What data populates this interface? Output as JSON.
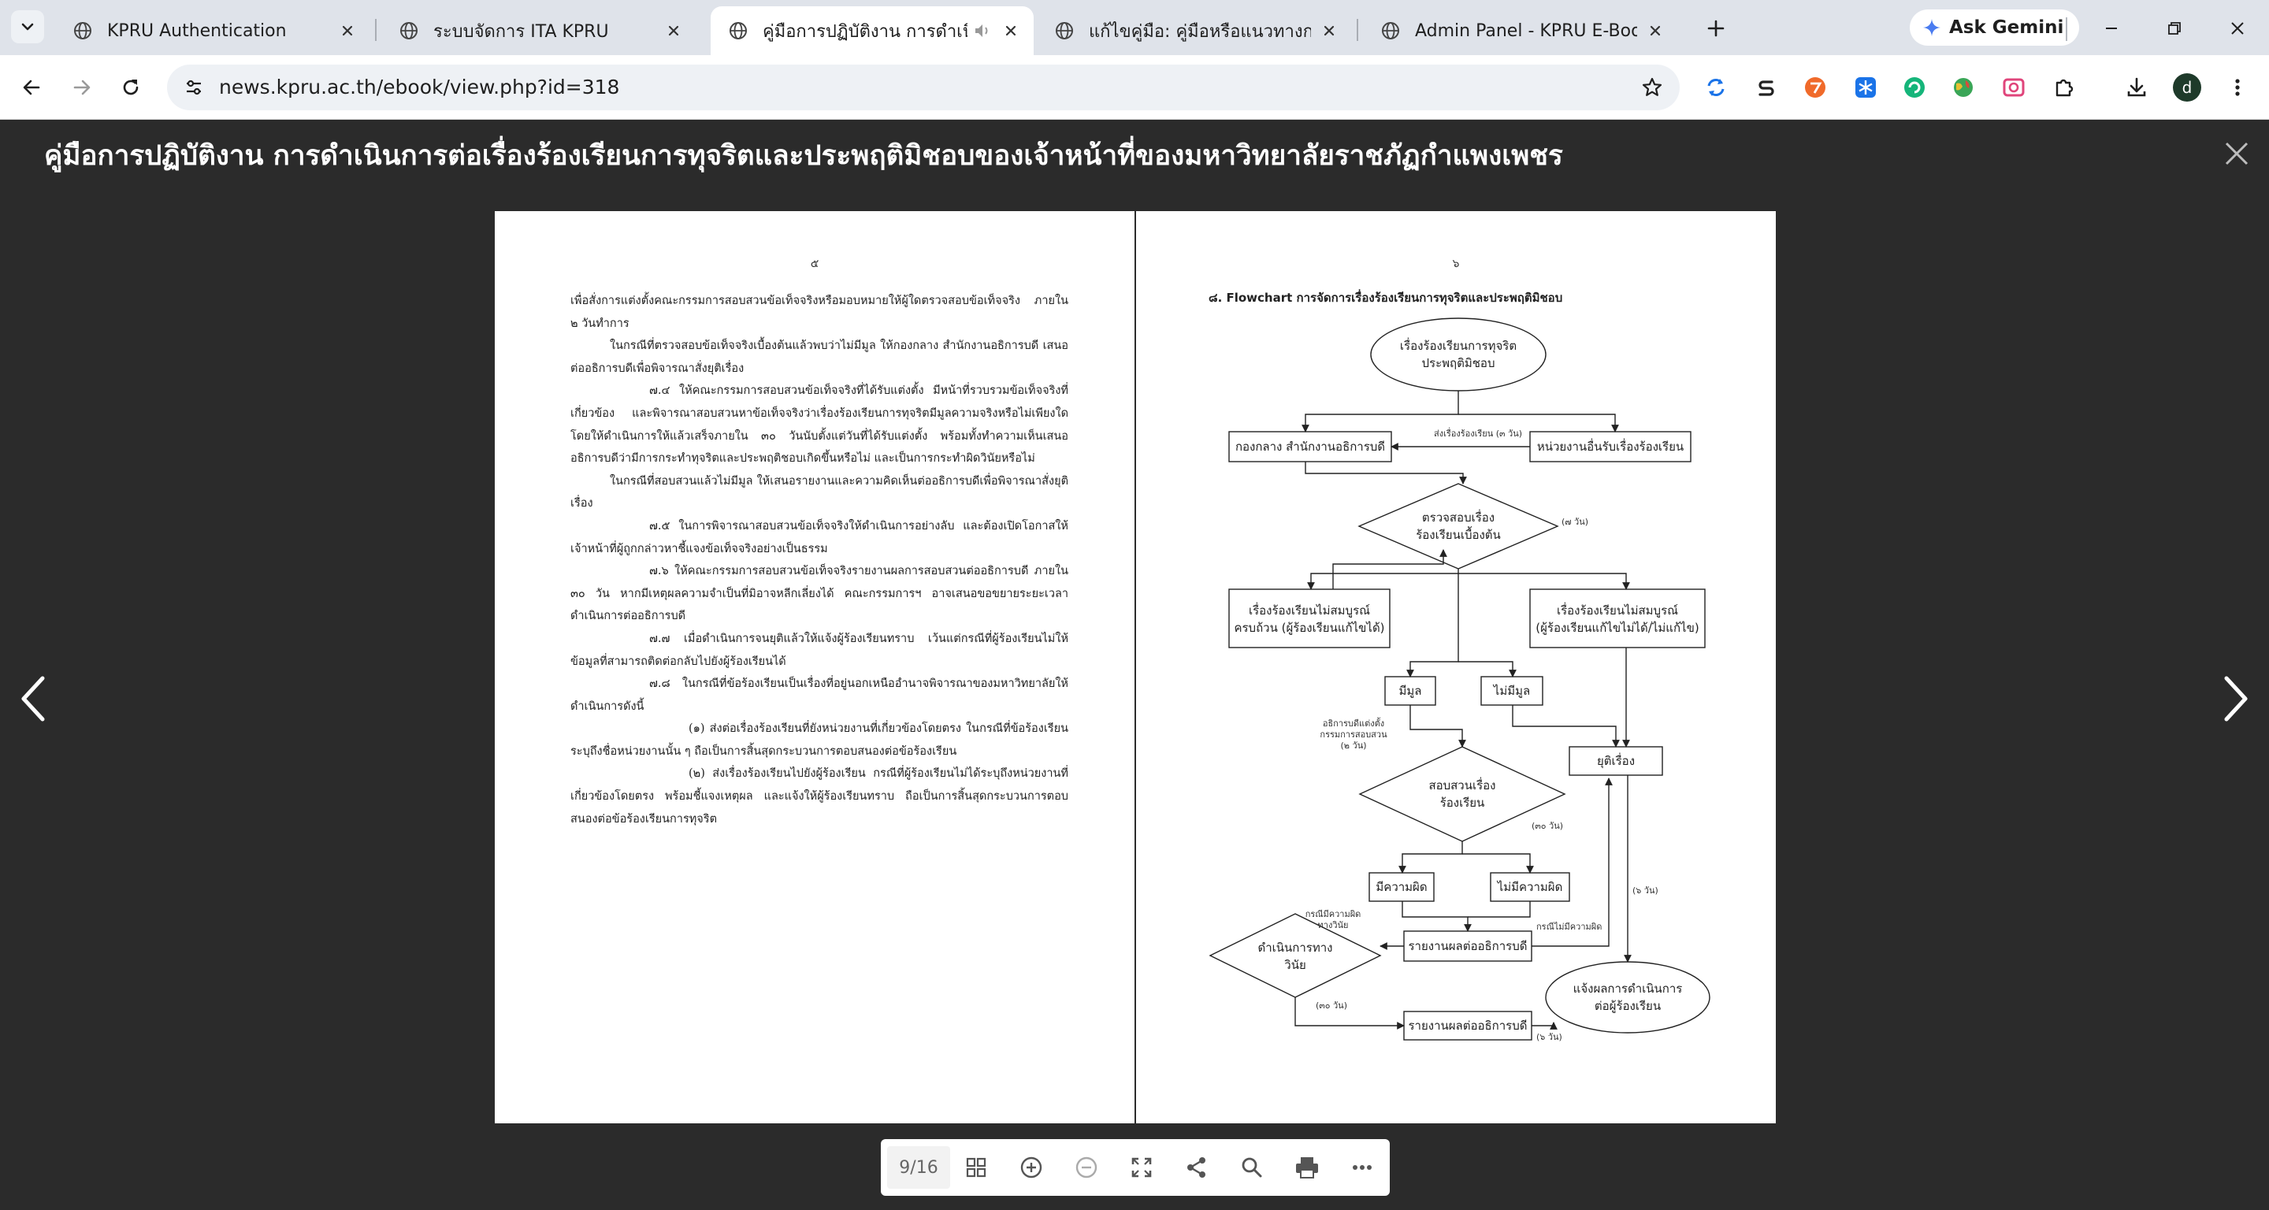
{
  "tabs": [
    {
      "title": "KPRU Authentication",
      "active": false
    },
    {
      "title": "ระบบจัดการ ITA KPRU",
      "active": false
    },
    {
      "title": "คู่มือการปฏิบัติงาน การดำเนินการ",
      "active": true
    },
    {
      "title": "แก้ไขคู่มือ: คู่มือหรือแนวทางการปฏิบั",
      "active": false
    },
    {
      "title": "Admin Panel - KPRU E-Books",
      "active": false
    }
  ],
  "gemini_label": "Ask Gemini",
  "address": {
    "url": "news.kpru.ac.th/ebook/view.php?id=318"
  },
  "profile_initial": "d",
  "viewer": {
    "title": "คู่มือการปฏิบัติงาน การดำเนินการต่อเรื่องร้องเรียนการทุจริตและประพฤติมิชอบของเจ้าหน้าที่ของมหาวิทยาลัยราชภัฏกำแพงเพชร",
    "page_indicator": "9/16"
  },
  "left_page": {
    "number": "๕",
    "paragraphs": [
      {
        "text": "เพื่อสั่งการแต่งตั้งคณะกรรมการสอบสวนข้อเท็จจริงหรือมอบหมายให้ผู้ใดตรวจสอบข้อเท็จจริง ภายใน ๒ วันทำการ",
        "indent": 0
      },
      {
        "text": "ในกรณีที่ตรวจสอบข้อเท็จจริงเบื้องต้นแล้วพบว่าไม่มีมูล ให้กองกลาง สำนักงานอธิการบดี เสนอต่ออธิการบดีเพื่อพิจารณาสั่งยุติเรื่อง",
        "indent": 1
      },
      {
        "text": "๗.๔ ให้คณะกรรมการสอบสวนข้อเท็จจริงที่ได้รับแต่งตั้ง มีหน้าที่รวบรวมข้อเท็จจริงที่เกี่ยวข้อง และพิจารณาสอบสวนหาข้อเท็จจริงว่าเรื่องร้องเรียนการทุจริตมีมูลความจริงหรือไม่เพียงใด โดยให้ดำเนินการให้แล้วเสร็จภายใน ๓๐ วันนับตั้งแต่วันที่ได้รับแต่งตั้ง พร้อมทั้งทำความเห็นเสนออธิการบดีว่ามีการกระทำทุจริตและประพฤติชอบเกิดขึ้นหรือไม่ และเป็นการกระทำผิดวินัยหรือไม่",
        "indent": 2
      },
      {
        "text": "ในกรณีที่สอบสวนแล้วไม่มีมูล ให้เสนอรายงานและความคิดเห็นต่ออธิการบดีเพื่อพิจารณาสั่งยุติเรื่อง",
        "indent": 1
      },
      {
        "text": "๗.๕ ในการพิจารณาสอบสวนข้อเท็จจริงให้ดำเนินการอย่างลับ และต้องเปิดโอกาสให้เจ้าหน้าที่ผู้ถูกกล่าวหาชี้แจงข้อเท็จจริงอย่างเป็นธรรม",
        "indent": 2
      },
      {
        "text": "๗.๖ ให้คณะกรรมการสอบสวนข้อเท็จจริงรายงานผลการสอบสวนต่ออธิการบดี ภายใน ๓๐ วัน หากมีเหตุผลความจำเป็นที่มิอาจหลีกเลี่ยงได้ คณะกรรมการฯ อาจเสนอขอขยายระยะเวลาดำเนินการต่ออธิการบดี",
        "indent": 2
      },
      {
        "text": "๗.๗ เมื่อดำเนินการจนยุติแล้วให้แจ้งผู้ร้องเรียนทราบ เว้นแต่กรณีที่ผู้ร้องเรียนไม่ให้ข้อมูลที่สามารถติดต่อกลับไปยังผู้ร้องเรียนได้",
        "indent": 2
      },
      {
        "text": "๗.๘ ในกรณีที่ข้อร้องเรียนเป็นเรื่องที่อยู่นอกเหนืออำนาจพิจารณาของมหาวิทยาลัยให้ดำเนินการดังนี้",
        "indent": 2
      },
      {
        "text": "(๑) ส่งต่อเรื่องร้องเรียนที่ยังหน่วยงานที่เกี่ยวข้องโดยตรง ในกรณีที่ข้อร้องเรียนระบุถึงชื่อหน่วยงานนั้น ๆ ถือเป็นการสิ้นสุดกระบวนการตอบสนองต่อข้อร้องเรียน",
        "indent": 3
      },
      {
        "text": "(๒) ส่งเรื่องร้องเรียนไปยังผู้ร้องเรียน กรณีที่ผู้ร้องเรียนไม่ได้ระบุถึงหน่วยงานที่เกี่ยวข้องโดยตรง พร้อมชี้แจงเหตุผล และแจ้งให้ผู้ร้องเรียนทราบ ถือเป็นการสิ้นสุดกระบวนการตอบสนองต่อข้อร้องเรียนการทุจริต",
        "indent": 3
      }
    ]
  },
  "right_page": {
    "number": "๖",
    "flowchart_title": "๘. Flowchart การจัดการเรื่องร้องเรียนการทุจริตและประพฤติมิชอบ",
    "nodes": {
      "start": [
        "เรื่องร้องเรียนการทุจริต",
        "ประพฤติมิชอบ"
      ],
      "central": "กองกลาง สำนักงานอธิการบดี",
      "receiver": "หน่วยงานอื่นรับเรื่องร้องเรียน",
      "check": [
        "ตรวจสอบเรื่อง",
        "ร้องเรียนเบื้องต้น"
      ],
      "complete": [
        "เรื่องร้องเรียนไม่สมบูรณ์",
        "ครบถ้วน (ผู้ร้องเรียนแก้ไขได้)"
      ],
      "incomplete": [
        "เรื่องร้องเรียนไม่สมบูรณ์",
        "(ผู้ร้องเรียนแก้ไขไม่ได้/ไม่แก้ไข)"
      ],
      "merit": "มีมูล",
      "no_merit": "ไม่มีมูล",
      "terminate": "ยุติเรื่อง",
      "investigate": [
        "สอบสวนเรื่อง",
        "ร้องเรียน"
      ],
      "guilty": "มีความผิด",
      "not_guilty": "ไม่มีความผิด",
      "discipline": [
        "ดำเนินการทาง",
        "วินัย"
      ],
      "report1": "รายงานผลต่ออธิการบดี",
      "report2": "รายงานผลต่ออธิการบดี",
      "notify": [
        "แจ้งผลการดำเนินการ",
        "ต่อผู้ร้องเรียน"
      ]
    },
    "notes": {
      "forward": "ส่งเรื่องร้องเรียน (๓ วัน)",
      "check_days": "(๗ วัน)",
      "appoint": [
        "อธิการบดีแต่งตั้ง",
        "กรรมการสอบสวน",
        "(๒ วัน)"
      ],
      "investigate_days": "(๓๐ วัน)",
      "guilty_note": [
        "กรณีมีความผิด",
        "ทางวินัย"
      ],
      "not_guilty_note": "กรณีไม่มีความผิด",
      "notify_days": "(๖ วัน)",
      "discipline_days": "(๓๐ วัน)",
      "report_days": "(๖ วัน)"
    }
  }
}
